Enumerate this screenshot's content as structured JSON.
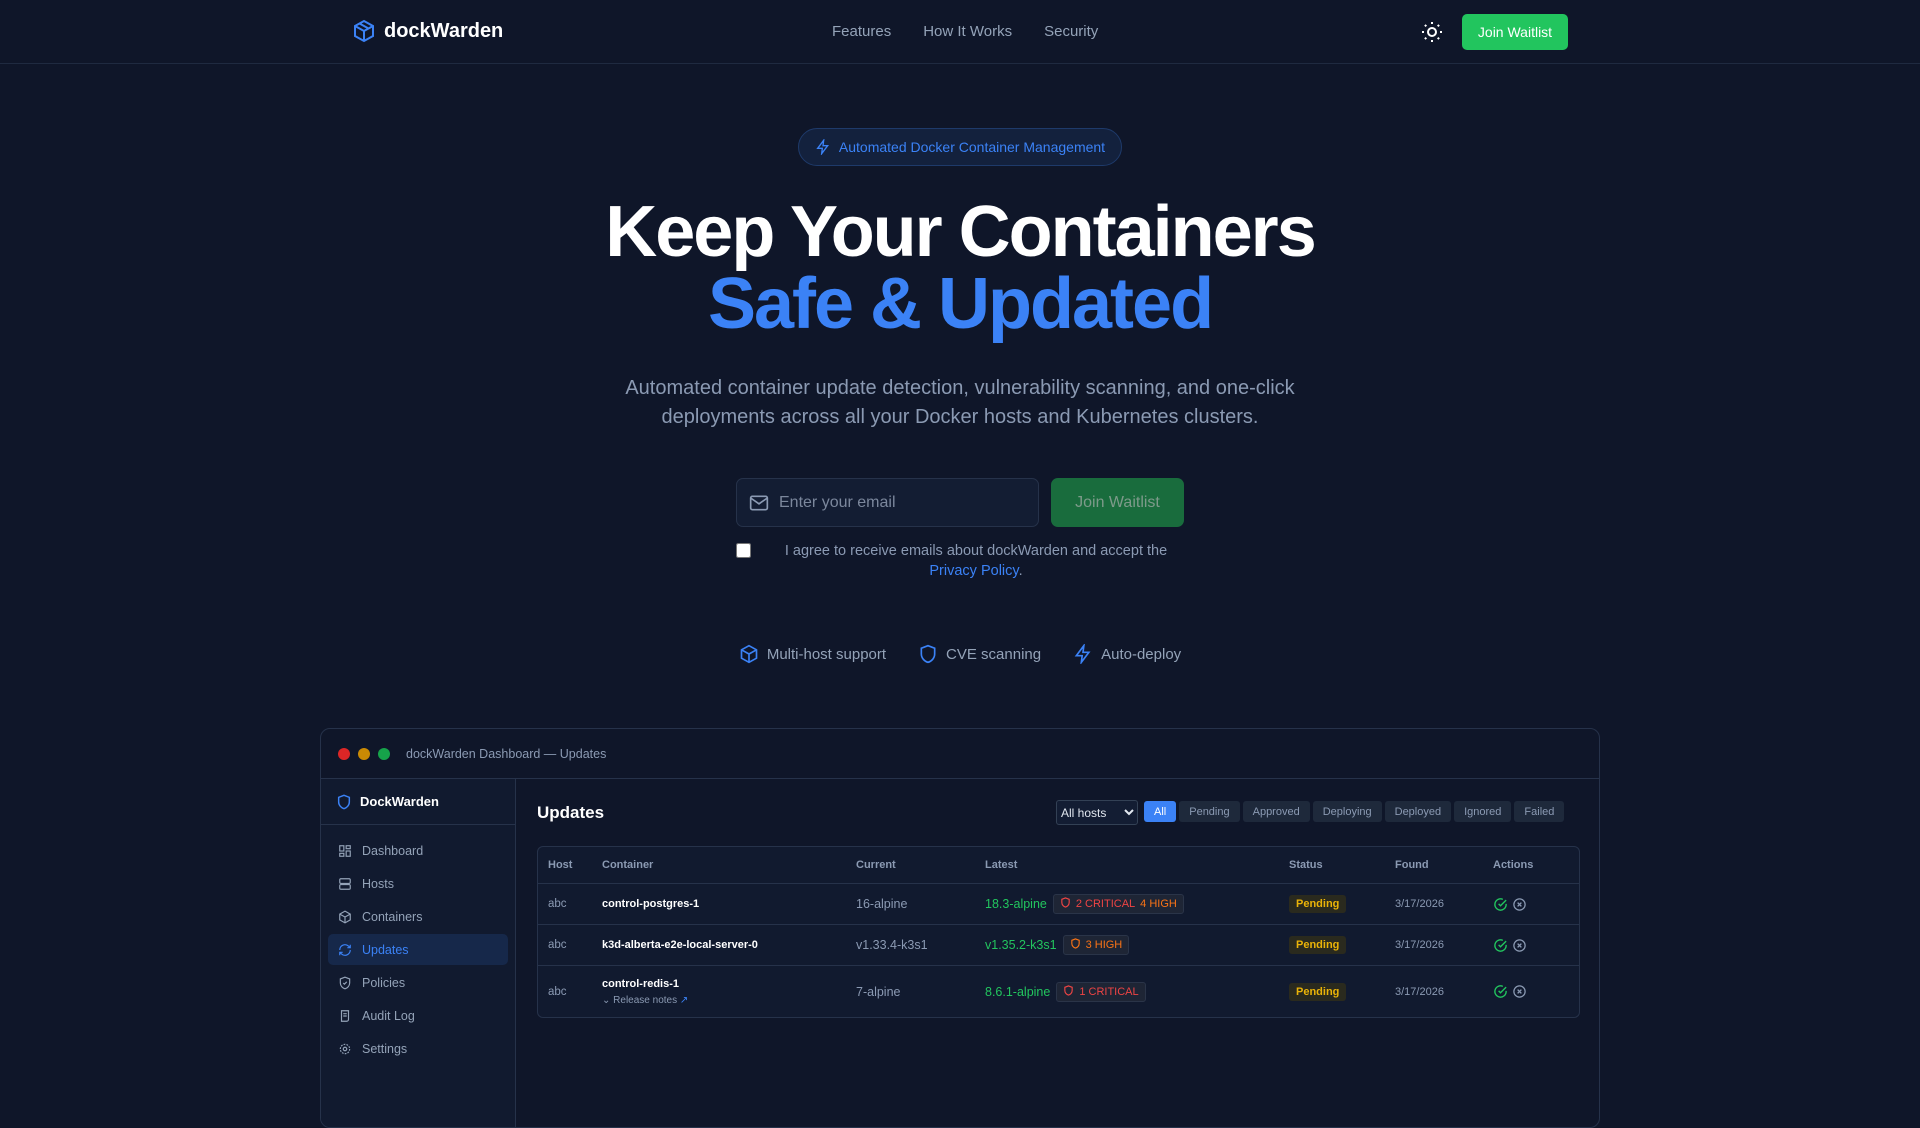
{
  "header": {
    "brand": "dockWarden",
    "nav": [
      "Features",
      "How It Works",
      "Security"
    ],
    "cta": "Join Waitlist"
  },
  "hero": {
    "badge": "Automated Docker Container Management",
    "title1": "Keep Your Containers",
    "title2": "Safe & Updated",
    "subtitle": "Automated container update detection, vulnerability scanning, and one-click deployments across all your Docker hosts and Kubernetes clusters.",
    "email_placeholder": "Enter your email",
    "join": "Join Waitlist",
    "agree_text": "I agree to receive emails about dockWarden and accept the ",
    "privacy": "Privacy Policy",
    "period": ".",
    "features": [
      "Multi-host support",
      "CVE scanning",
      "Auto-deploy"
    ]
  },
  "dashboard": {
    "window_title": "dockWarden Dashboard — Updates",
    "brand": "DockWarden",
    "sidebar": [
      "Dashboard",
      "Hosts",
      "Containers",
      "Updates",
      "Policies",
      "Audit Log",
      "Settings"
    ],
    "title": "Updates",
    "host_filter": "All hosts",
    "filters": [
      "All",
      "Pending",
      "Approved",
      "Deploying",
      "Deployed",
      "Ignored",
      "Failed"
    ],
    "columns": [
      "Host",
      "Container",
      "Current",
      "Latest",
      "Status",
      "Found",
      "Actions"
    ],
    "rows": [
      {
        "host": "abc",
        "container": "control-postgres-1",
        "current": "16-alpine",
        "latest": "18.3-alpine",
        "critical": "2 CRITICAL",
        "high": "4 HIGH",
        "status": "Pending",
        "found": "3/17/2026"
      },
      {
        "host": "abc",
        "container": "k3d-alberta-e2e-local-server-0",
        "current": "v1.33.4-k3s1",
        "latest": "v1.35.2-k3s1",
        "critical": "",
        "high": "3 HIGH",
        "status": "Pending",
        "found": "3/17/2026"
      },
      {
        "host": "abc",
        "container": "control-redis-1",
        "release_notes": "Release notes",
        "current": "7-alpine",
        "latest": "8.6.1-alpine",
        "critical": "1 CRITICAL",
        "high": "",
        "status": "Pending",
        "found": "3/17/2026"
      }
    ]
  }
}
